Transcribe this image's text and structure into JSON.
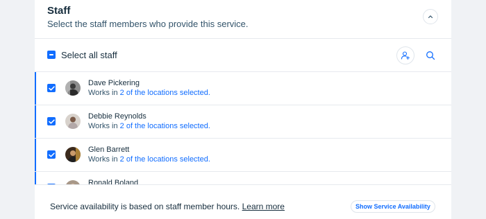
{
  "header": {
    "title": "Staff",
    "subtitle": "Select the staff members who provide this service."
  },
  "select_all": {
    "label": "Select all staff"
  },
  "staff": [
    {
      "name": "Dave Pickering",
      "works_prefix": "Works in",
      "works_link": "2 of the locations selected.",
      "checked": true,
      "avatar_icon": "person-avatar"
    },
    {
      "name": "Debbie Reynolds",
      "works_prefix": "Works in",
      "works_link": "2 of the locations selected.",
      "checked": true,
      "avatar_icon": "person-avatar"
    },
    {
      "name": "Glen Barrett",
      "works_prefix": "Works in",
      "works_link": "2 of the locations selected.",
      "checked": true,
      "avatar_icon": "person-avatar"
    },
    {
      "name": "Ronald Boland",
      "works_prefix": "",
      "works_link": "",
      "checked": true,
      "avatar_icon": "person-avatar"
    }
  ],
  "footer": {
    "text": "Service availability is based on staff member hours.",
    "link": "Learn more",
    "button": "Show Service Availability"
  },
  "colors": {
    "accent": "#116dff",
    "text": "#162d3d",
    "border": "#e6e9ee",
    "background": "#f0f2f5"
  },
  "icons": {
    "collapse": "chevron-up-icon",
    "add_staff": "add-person-icon",
    "search": "search-icon"
  }
}
